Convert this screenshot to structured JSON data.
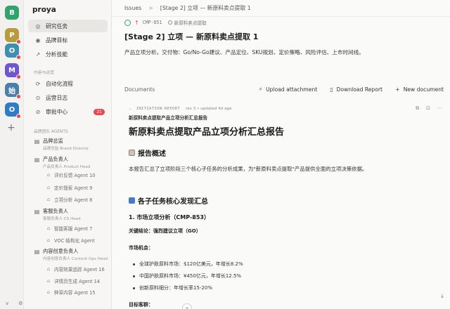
{
  "workspaces": [
    {
      "letter": "B",
      "color": "#30a46c",
      "dot": false
    },
    {
      "letter": "P",
      "color": "#b89b3e",
      "dot": true
    },
    {
      "letter": "O",
      "color": "#3e8fb0",
      "dot": true
    },
    {
      "letter": "M",
      "color": "#6e56cf",
      "dot": true
    },
    {
      "letter": "始",
      "color": "#4a7fa8",
      "dot": true
    },
    {
      "letter": "O",
      "color": "#2f7cc4",
      "dot": true
    }
  ],
  "sidebar": {
    "brand": "proya",
    "nav": [
      {
        "label": "研究任务",
        "icon": "◎",
        "active": true
      },
      {
        "label": "品牌目标",
        "icon": "◉",
        "active": false
      },
      {
        "label": "分析技能",
        "icon": "↗",
        "active": false
      }
    ],
    "section_ops": "内容与运营",
    "ops": [
      {
        "label": "自动化流程",
        "icon": "⟳"
      },
      {
        "label": "运营日志",
        "icon": "⊙"
      },
      {
        "label": "审批中心",
        "icon": "⊘",
        "badge": "21"
      }
    ],
    "section_agents": "品牌团队 AGENTS",
    "groups": [
      {
        "title": "品牌总监",
        "sub": "品牌总监 Brand Director"
      },
      {
        "title": "产品负责人",
        "sub": "产品负责人 Product Head"
      },
      {
        "title": "客服负责人",
        "sub": "客服负责人 CS Head"
      },
      {
        "title": "内容创意负责人",
        "sub": "内容创意负责人 Content Ops Head"
      }
    ],
    "agents": [
      "评价反馈 Agent 10",
      "定价搜索 Agent 9",
      "立项分析 Agent 8",
      "智能客服 Agent 7",
      "VOC 结构化 Agent",
      "内容效果追踪 Agent 16",
      "详情页生成 Agent 14",
      "种草内容 Agent 15"
    ],
    "bottom": [
      "v",
      "⚙"
    ]
  },
  "topbar": {
    "crumb_root": "Issues",
    "crumb_sep": ">",
    "crumb_current": "[Stage 2] 立项 — 新原料卖点提取 1"
  },
  "issue": {
    "id": "CMP-851",
    "status": "新原料卖点提取",
    "title": "[Stage 2] 立项 — 新原料卖点提取 1",
    "description": "产品立项分析。交付物：Go/No-Go建议、产品定位、SKU规划、定价策略、风险评估、上市时间线。"
  },
  "documents": {
    "label": "Documents",
    "upload": "Upload attachment",
    "download": "Download Report",
    "new_doc": "New document"
  },
  "doc": {
    "type": "INITIATION-REPORT",
    "meta": "rev 3 • updated 4d ago",
    "small_title": "新原料卖点提取产品立项分析汇总报告",
    "h1": "新原料卖点提取产品立项分析汇总报告",
    "h2_overview": "报告概述",
    "overview": "本报告汇总了立项阶段三个核心子任务的分析成果，为\"新原料卖点提取\"产品提供全面的立项决策依据。",
    "h2_findings": "各子任务核心发现汇总",
    "h3_market": "1. 市场立项分析（CMP-853）",
    "conclusion": "关键结论：强烈建议立项（GO）",
    "market_label": "市场机会：",
    "market_items": [
      "全球护肤原料市场：$120亿美元，年增长8.2%",
      "中国护肤原料市场：¥450亿元，年增长12.5%",
      "创新原料细分：年增长率15-20%"
    ],
    "target_label": "目标客群："
  },
  "colors": {
    "accent_green": "#30a46c",
    "badge_red": "#e5484d"
  }
}
